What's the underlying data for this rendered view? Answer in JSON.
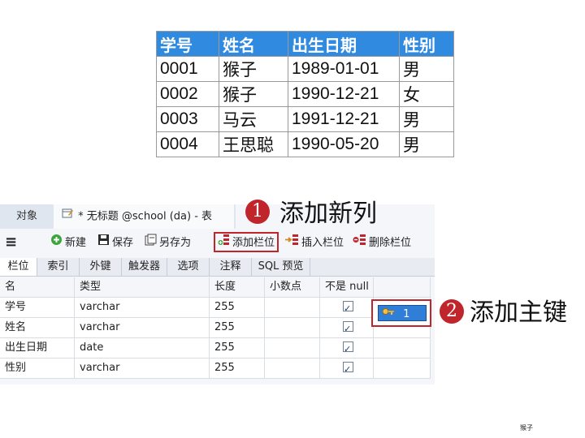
{
  "student_table": {
    "headers": [
      "学号",
      "姓名",
      "出生日期",
      "性别"
    ],
    "rows": [
      [
        "0001",
        "猴子",
        "1989-01-01",
        "男"
      ],
      [
        "0002",
        "猴子",
        "1990-12-21",
        "女"
      ],
      [
        "0003",
        "马云",
        "1991-12-21",
        "男"
      ],
      [
        "0004",
        "王思聪",
        "1990-05-20",
        "男"
      ]
    ]
  },
  "window": {
    "tabs": {
      "objects": "对象",
      "table": "* 无标题 @school (da) - 表"
    },
    "toolbar": {
      "menu": "≡",
      "new": "新建",
      "save": "保存",
      "save_as": "另存为",
      "add_field": "添加栏位",
      "insert_field": "插入栏位",
      "delete_field": "删除栏位"
    },
    "subtabs": [
      "栏位",
      "索引",
      "外键",
      "触发器",
      "选项",
      "注释",
      "SQL 预览"
    ],
    "columns": [
      "名",
      "类型",
      "长度",
      "小数点",
      "不是 null"
    ],
    "fields": [
      {
        "name": "学号",
        "type": "varchar",
        "length": "255",
        "decimals": "",
        "not_null": true
      },
      {
        "name": "姓名",
        "type": "varchar",
        "length": "255",
        "decimals": "",
        "not_null": true
      },
      {
        "name": "出生日期",
        "type": "date",
        "length": "255",
        "decimals": "",
        "not_null": true
      },
      {
        "name": "性别",
        "type": "varchar",
        "length": "255",
        "decimals": "",
        "not_null": true
      }
    ],
    "primary_key_value": "1"
  },
  "callouts": {
    "step1_number": "1",
    "step1_text": "添加新列",
    "step2_number": "2",
    "step2_text": "添加主键"
  },
  "footer_note": "猴子",
  "colors": {
    "header_blue": "#2f8ae0",
    "callout_red": "#c0252b",
    "key_blue": "#2f7fd8"
  }
}
